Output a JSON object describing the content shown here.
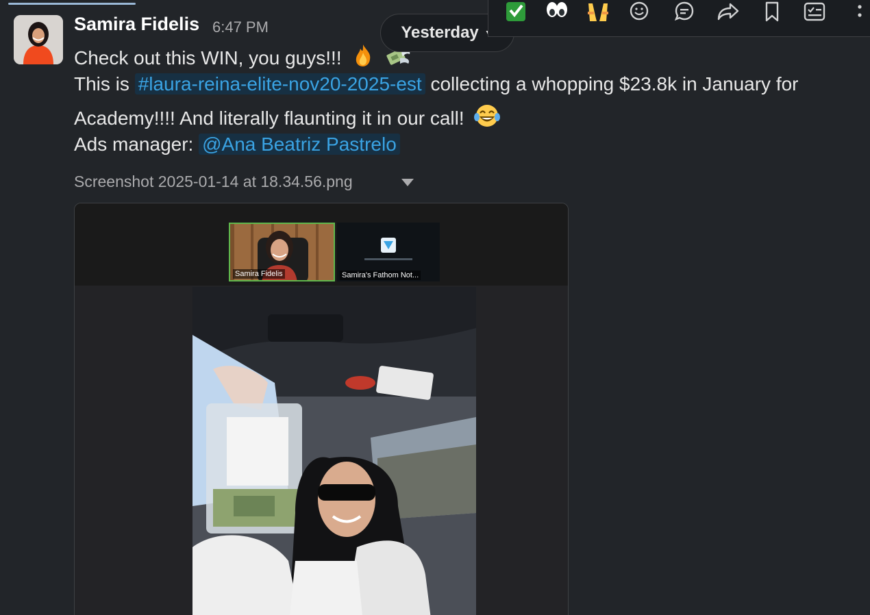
{
  "message": {
    "sender": "Samira Fidelis",
    "time": "6:47 PM",
    "line1": "Check out this WIN, you guys!!!",
    "line2_prefix": "This is",
    "channel": "#laura-reina-elite-nov20-2025-est",
    "line2_suffix": "collecting a whopping $23.8k in January for",
    "line3": "Academy!!!! And literally flaunting it in our call!",
    "line4_prefix": "Ads manager:",
    "mention": "@Ana Beatriz Pastrelo"
  },
  "date_divider": {
    "label": "Yesterday"
  },
  "attachment": {
    "file_name": "Screenshot 2025-01-14 at 18.34.56.png",
    "call_tiles": [
      {
        "label": "Samira Fidelis"
      },
      {
        "label": "Samira's Fathom Not..."
      }
    ]
  },
  "toolbar": {
    "icons": [
      "check-mark-emoji-icon",
      "eyes-emoji-icon",
      "raised-hands-emoji-icon",
      "add-reaction-icon",
      "reply-in-thread-icon",
      "share-icon",
      "bookmark-icon",
      "add-to-list-icon",
      "more-actions-icon"
    ]
  },
  "colors": {
    "background": "#222529",
    "link": "#3aa3e3",
    "link_bg": "#173043",
    "text": "#e8e8e8",
    "muted": "#ababad"
  }
}
